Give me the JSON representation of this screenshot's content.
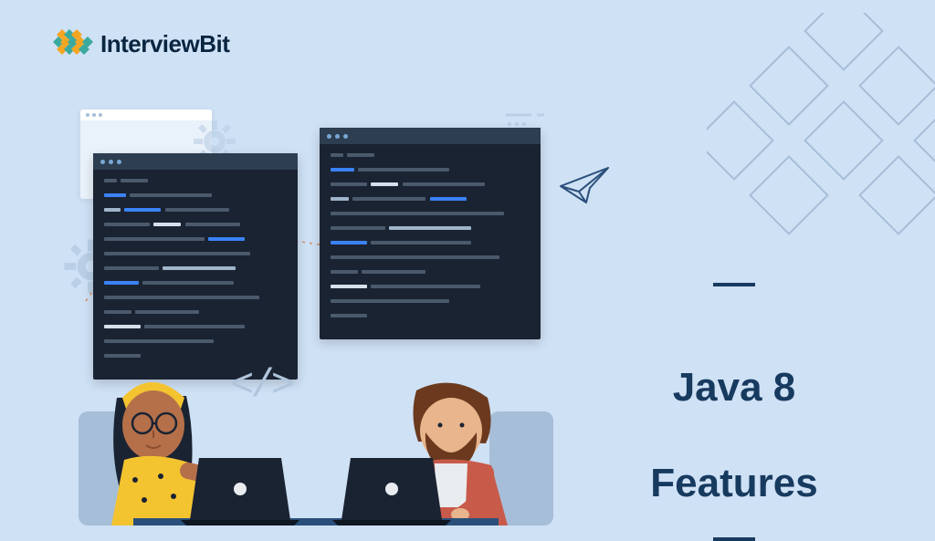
{
  "logo": {
    "text": "InterviewBit"
  },
  "title": {
    "line1": "Java 8",
    "line2": "Features"
  },
  "decor": {
    "brackets": "</>"
  }
}
